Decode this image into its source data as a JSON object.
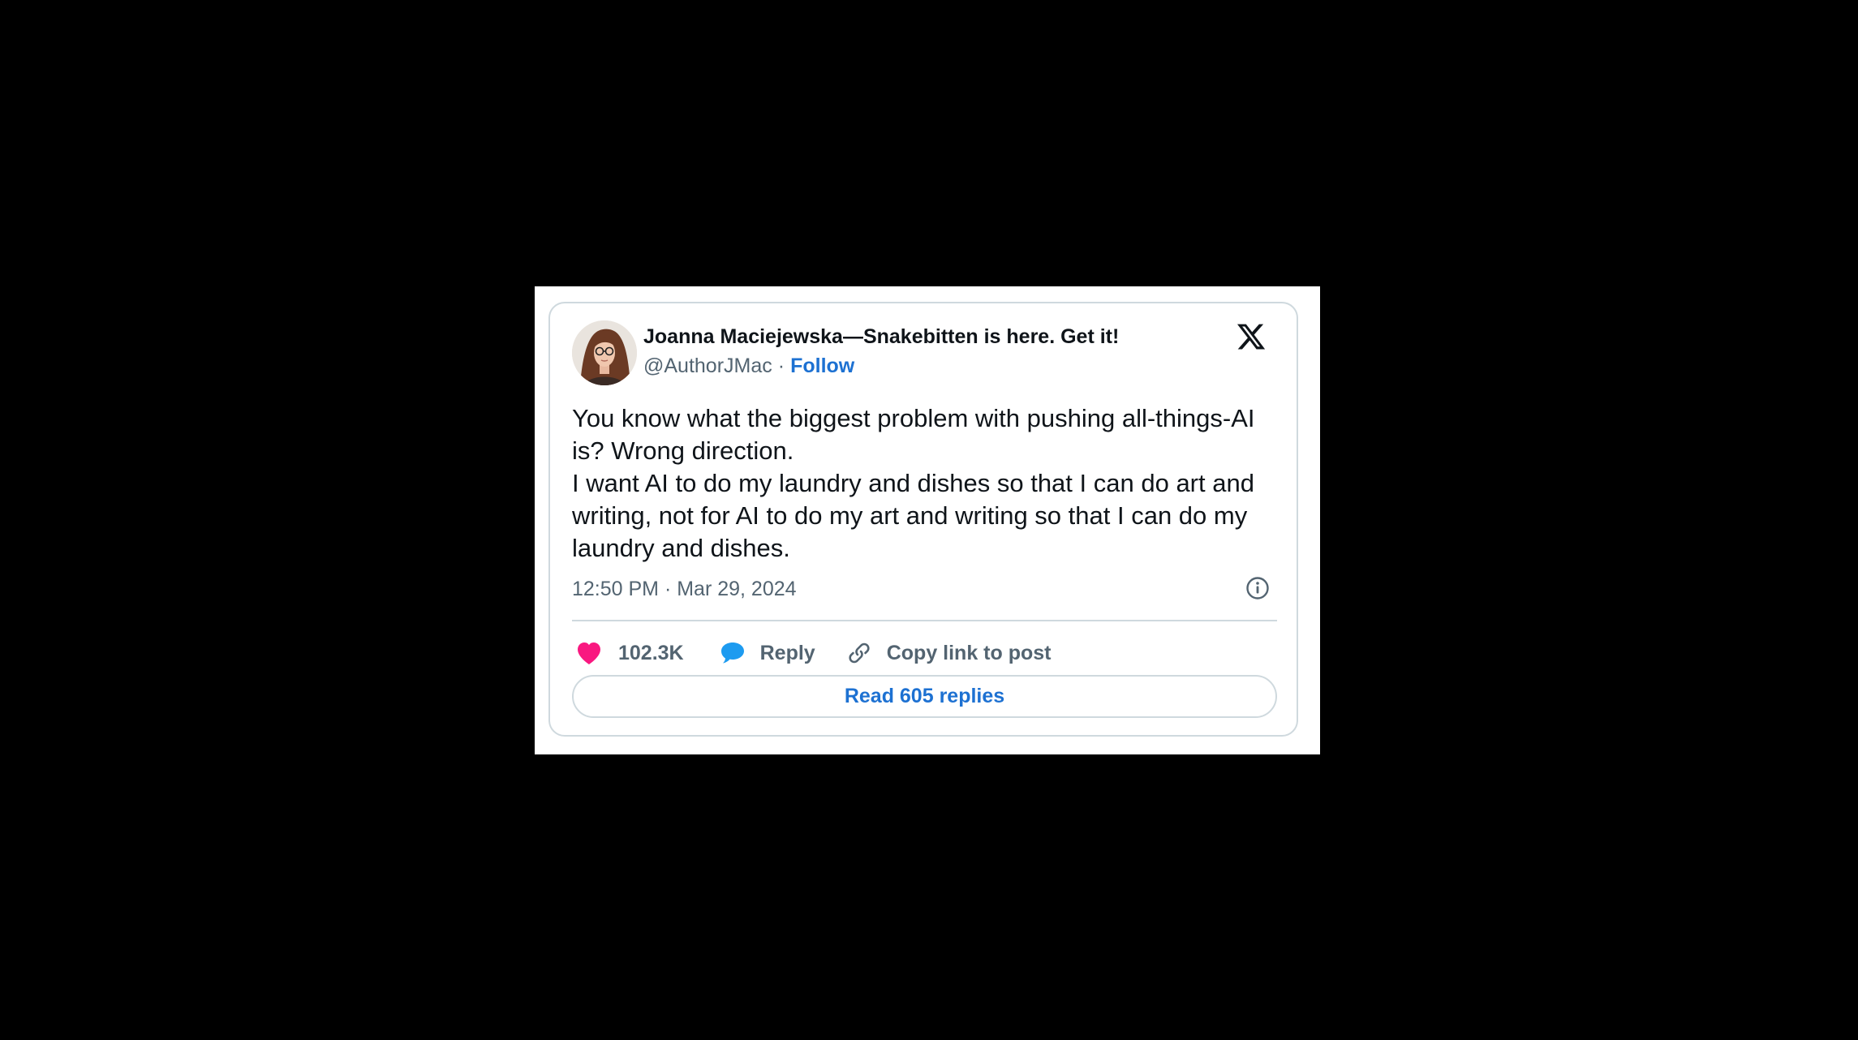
{
  "author": {
    "display_name": "Joanna Maciejewska—Snakebitten is here. Get it!",
    "handle": "@AuthorJMac",
    "separator": "·",
    "follow_label": "Follow"
  },
  "tweet": {
    "line1": "You know what the biggest problem with pushing all-things-AI is? Wrong direction.",
    "line2": "I want AI to do my laundry and dishes so that I can do art and writing, not for AI to do my art and writing so that I can do my laundry and dishes.",
    "timestamp": "12:50 PM · Mar 29, 2024"
  },
  "actions": {
    "likes": "102.3K",
    "reply_label": "Reply",
    "copy_label": "Copy link to post",
    "read_replies_label": "Read 605 replies"
  },
  "icons": {
    "brand": "x-logo-icon",
    "info": "info-icon",
    "like": "heart-icon",
    "reply": "speech-bubble-icon",
    "copy": "link-icon"
  },
  "colors": {
    "link": "#1d71d2",
    "heart": "#f91880",
    "reply_bubble": "#1d9bf0",
    "secondary_text": "#536471",
    "border": "#cfd9de",
    "background": "#000000"
  }
}
